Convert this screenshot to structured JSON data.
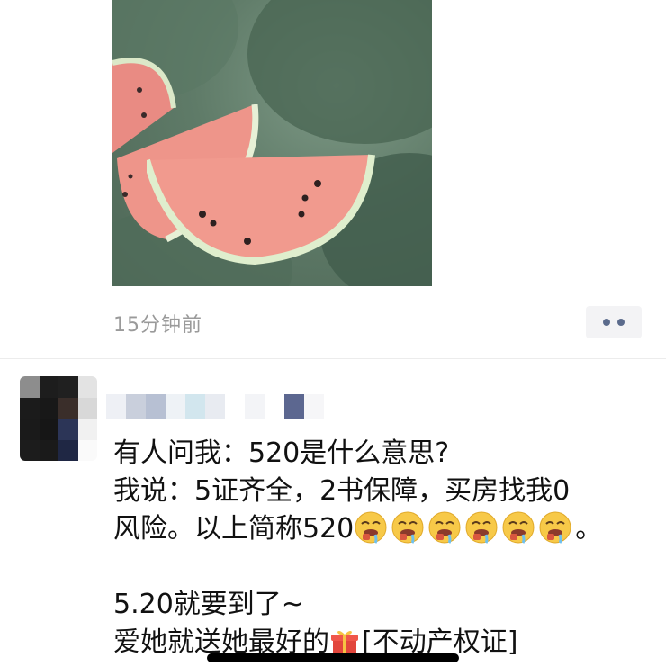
{
  "post_image": {
    "subject": "watermelon-slices-photo"
  },
  "post_meta": {
    "time": "15分钟前"
  },
  "actions": {
    "more_icon": "more-dots-icon"
  },
  "comment": {
    "line1": "有人问我：520是什么意思?",
    "line2": "我说：5证齐全，2书保障，买房找我0",
    "line3_text": "风险。以上简称520",
    "line3_end": "。",
    "emoji_icon": "drooling-face-emoji",
    "emoji_count": 6,
    "line5": "5.20就要到了~",
    "line6_prefix": "爱她就送她最好的",
    "gift_icon": "gift-emoji",
    "line6_suffix": "[不动产权证]"
  },
  "colors": {
    "time_text": "#9a9a9a",
    "more_dots": "#5b6b8c",
    "more_bg": "#f3f3f5",
    "body_text": "#111111"
  }
}
